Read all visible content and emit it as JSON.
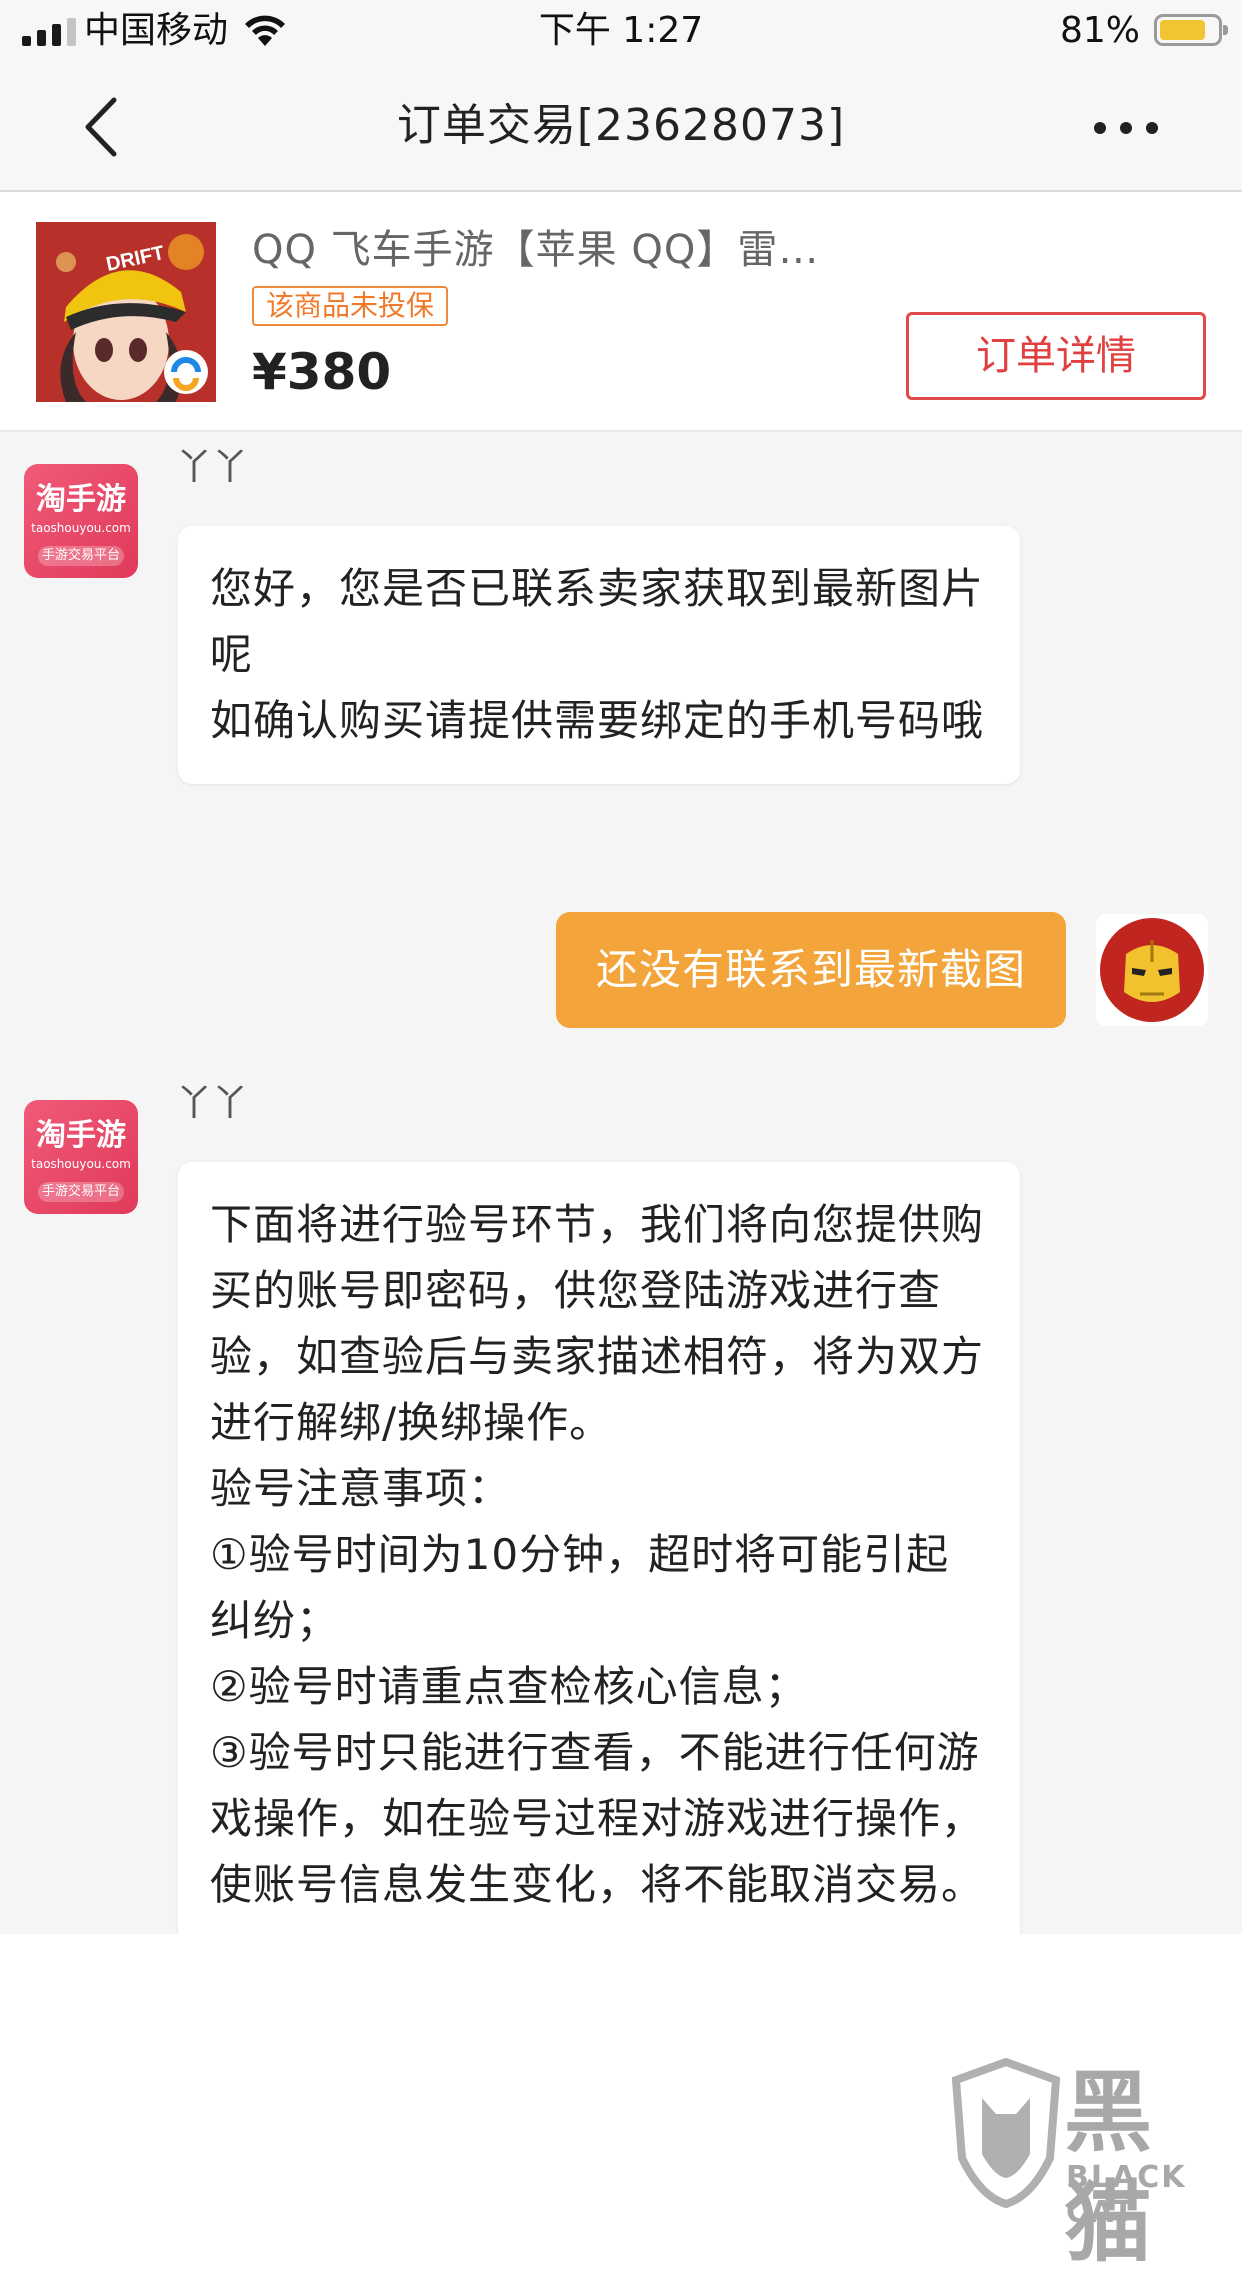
{
  "status_bar": {
    "carrier": "中国移动",
    "time": "下午 1:27",
    "battery_percent": "81%",
    "battery_level": 0.81,
    "signal_bars_active": 3,
    "signal_bars_total": 4
  },
  "nav": {
    "title": "订单交易[23628073]",
    "back_icon": "chevron-left-icon",
    "more_icon": "more-dots-icon"
  },
  "product": {
    "title": "QQ 飞车手游【苹果 QQ】雷…",
    "badge": "该商品未投保",
    "price": "¥380",
    "detail_button": "订单详情",
    "thumbnail_text": "DRIFT"
  },
  "shop": {
    "logo_main": "淘手游",
    "logo_url": "taoshouyou.com",
    "logo_sub": "手游交易平台"
  },
  "messages": [
    {
      "from": "agent",
      "sender": "丫丫",
      "lines": [
        "您好，您是否已联系卖家获取到最新图片呢",
        "如确认购买请提供需要绑定的手机号码哦"
      ]
    },
    {
      "from": "self",
      "text": "还没有联系到最新截图"
    },
    {
      "from": "agent",
      "sender": "丫丫",
      "lines": [
        "下面将进行验号环节，我们将向您提供购买的账号即密码，供您登陆游戏进行查验，如查验后与卖家描述相符，将为双方进行解绑/换绑操作。",
        "验号注意事项：",
        "①验号时间为10分钟，超时将可能引起纠纷；",
        "②验号时请重点查检核心信息；",
        "③验号时只能进行查看，不能进行任何游戏操作，如在验号过程对游戏进行操作，使账号信息发生变化，将不能取消交易。"
      ]
    }
  ],
  "watermark": {
    "main": "黑猫",
    "sub": "BLACK CAT"
  },
  "colors": {
    "accent_orange": "#f3a43a",
    "detail_red": "#e04040",
    "badge_orange": "#f07a2a",
    "shop_pink": "#e8456a"
  }
}
